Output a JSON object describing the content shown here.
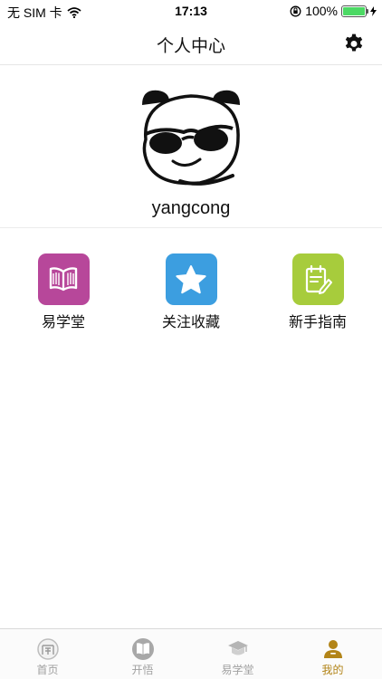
{
  "status_bar": {
    "carrier": "无 SIM 卡",
    "time": "17:13",
    "battery_percent": "100%",
    "battery_level": 1.0
  },
  "nav": {
    "title": "个人中心"
  },
  "profile": {
    "username": "yangcong"
  },
  "shortcuts": [
    {
      "label": "易学堂",
      "icon": "book-icon",
      "color": "#b7479a"
    },
    {
      "label": "关注收藏",
      "icon": "star-icon",
      "color": "#3c9ee0"
    },
    {
      "label": "新手指南",
      "icon": "guide-note-icon",
      "color": "#a7cc3c"
    }
  ],
  "tab_bar": {
    "items": [
      {
        "label": "首页",
        "icon": "home-icon",
        "active": false
      },
      {
        "label": "开悟",
        "icon": "open-book-icon",
        "active": false
      },
      {
        "label": "易学堂",
        "icon": "graduation-cap-icon",
        "active": false
      },
      {
        "label": "我的",
        "icon": "person-icon",
        "active": true
      }
    ],
    "active_color": "#b28418",
    "inactive_color": "#a0a0a0"
  }
}
